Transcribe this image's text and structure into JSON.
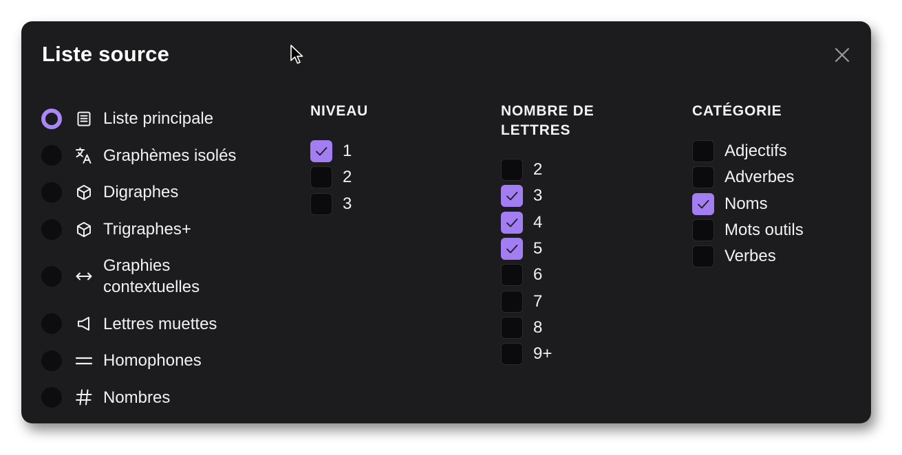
{
  "dialog": {
    "title": "Liste source",
    "close_icon": "close-icon"
  },
  "sources": [
    {
      "label": "Liste principale",
      "icon": "list-document-icon",
      "selected": true
    },
    {
      "label": "Graphèmes isolés",
      "icon": "translate-icon",
      "selected": false
    },
    {
      "label": "Digraphes",
      "icon": "cube-icon",
      "selected": false
    },
    {
      "label": "Trigraphes+",
      "icon": "cube-icon",
      "selected": false
    },
    {
      "label": "Graphies contextuelles",
      "icon": "left-right-arrow-icon",
      "selected": false
    },
    {
      "label": "Lettres muettes",
      "icon": "speaker-icon",
      "selected": false
    },
    {
      "label": "Homophones",
      "icon": "equals-icon",
      "selected": false
    },
    {
      "label": "Nombres",
      "icon": "hash-icon",
      "selected": false
    }
  ],
  "niveau": {
    "heading": "NIVEAU",
    "options": [
      {
        "label": "1",
        "checked": true
      },
      {
        "label": "2",
        "checked": false
      },
      {
        "label": "3",
        "checked": false
      }
    ]
  },
  "lettres": {
    "heading_line1": "NOMBRE DE",
    "heading_line2": "LETTRES",
    "options": [
      {
        "label": "2",
        "checked": false
      },
      {
        "label": "3",
        "checked": true
      },
      {
        "label": "4",
        "checked": true
      },
      {
        "label": "5",
        "checked": true
      },
      {
        "label": "6",
        "checked": false
      },
      {
        "label": "7",
        "checked": false
      },
      {
        "label": "8",
        "checked": false
      },
      {
        "label": "9+",
        "checked": false
      }
    ]
  },
  "categorie": {
    "heading": "CATÉGORIE",
    "options": [
      {
        "label": "Adjectifs",
        "checked": false
      },
      {
        "label": "Adverbes",
        "checked": false
      },
      {
        "label": "Noms",
        "checked": true
      },
      {
        "label": "Mots outils",
        "checked": false
      },
      {
        "label": "Verbes",
        "checked": false
      }
    ]
  },
  "colors": {
    "accent": "#a27ef2",
    "panel": "#1c1b1e"
  }
}
